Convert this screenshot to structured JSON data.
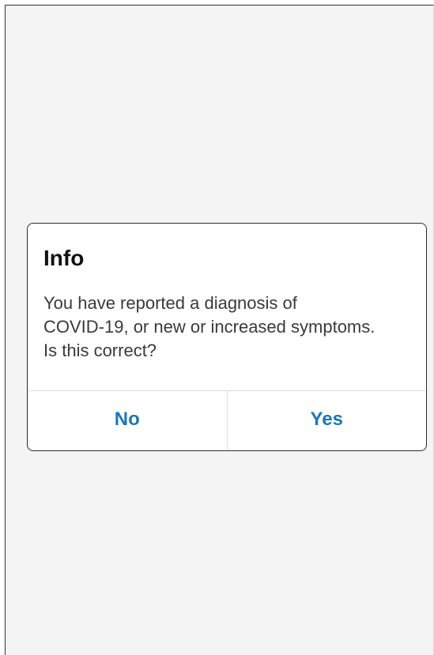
{
  "dialog": {
    "title": "Info",
    "message_lines": [
      "You have reported a diagnosis of",
      "COVID-19, or new or increased symptoms.",
      "Is this correct?"
    ],
    "buttons": {
      "no_label": "No",
      "yes_label": "Yes"
    }
  },
  "colors": {
    "background": "#f4f4f4",
    "dialog": "#ffffff",
    "accent": "#1a77b8",
    "title_text": "#111111",
    "body_text": "#3a3a3a"
  }
}
